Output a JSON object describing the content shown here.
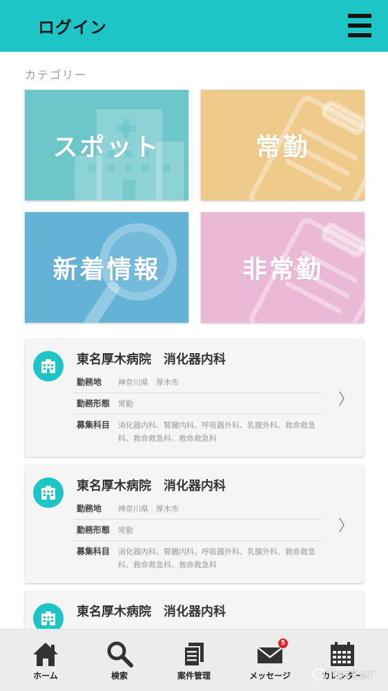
{
  "header": {
    "title": "ログイン",
    "menu_icon": "hamburger-icon"
  },
  "category": {
    "label": "カテゴリー",
    "tiles": [
      {
        "label": "スポット",
        "color": "#6dc6c9",
        "icon": "hospital-icon"
      },
      {
        "label": "常勤",
        "color": "#efcb8b",
        "icon": "clipboard-icon"
      },
      {
        "label": "新着情報",
        "color": "#64b3d7",
        "icon": "magnifier-icon"
      },
      {
        "label": "非常勤",
        "color": "#eab9d6",
        "icon": "clipboard-icon"
      }
    ]
  },
  "jobs": [
    {
      "name": "東名厚木病院　消化器内科",
      "icon": "hospital-icon",
      "fields": [
        {
          "label": "勤務地",
          "value": "神奈川県　厚木市"
        },
        {
          "label": "勤務形態",
          "value": "常勤"
        },
        {
          "label": "募集科目",
          "value": "消化器内科、腎臓内科、呼吸器外科、乳腺外科、救命救急科、救命救急科、救命救急科"
        }
      ]
    },
    {
      "name": "東名厚木病院　消化器内科",
      "icon": "hospital-icon",
      "fields": [
        {
          "label": "勤務地",
          "value": "神奈川県　厚木市"
        },
        {
          "label": "勤務形態",
          "value": "常勤"
        },
        {
          "label": "募集科目",
          "value": "消化器内科、腎臓内科、呼吸器外科、乳腺外科、救命救急科、救命救急科、救命救急科"
        }
      ]
    },
    {
      "name": "東名厚木病院　消化器内科",
      "icon": "hospital-icon",
      "fields": []
    }
  ],
  "tabbar": {
    "tabs": [
      {
        "label": "ホーム",
        "icon": "home-icon"
      },
      {
        "label": "検索",
        "icon": "search-icon"
      },
      {
        "label": "案件管理",
        "icon": "documents-icon"
      },
      {
        "label": "メッセージ",
        "icon": "mail-icon",
        "badge": "5"
      },
      {
        "label": "カレンダー",
        "icon": "calendar-icon"
      }
    ]
  },
  "watermark": "Tusker",
  "colors": {
    "accent": "#1dc5c7",
    "badge": "#e5202a"
  }
}
